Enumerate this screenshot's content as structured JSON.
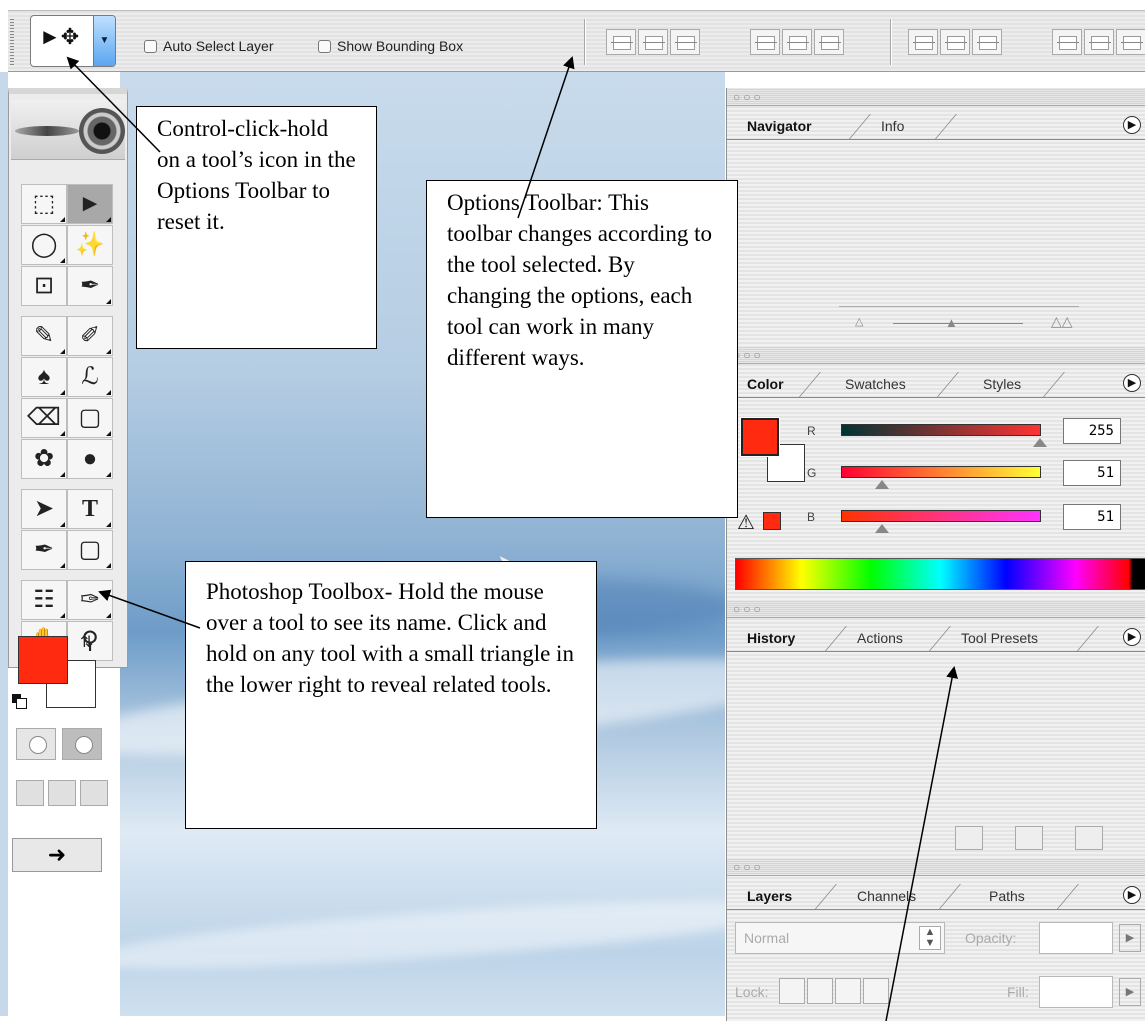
{
  "options_toolbar": {
    "auto_select_label": "Auto Select Layer",
    "show_bbox_label": "Show Bounding Box"
  },
  "palettes": {
    "navigator_tabs": [
      "Navigator",
      "Info"
    ],
    "color_tabs": [
      "Color",
      "Swatches",
      "Styles"
    ],
    "color_values": {
      "r_label": "R",
      "r": "255",
      "g_label": "G",
      "g": "51",
      "b_label": "B",
      "b": "51"
    },
    "history_tabs": [
      "History",
      "Actions",
      "Tool Presets"
    ],
    "layers_tabs": [
      "Layers",
      "Channels",
      "Paths"
    ],
    "layers": {
      "blend_mode": "Normal",
      "opacity_label": "Opacity:",
      "lock_label": "Lock:",
      "fill_label": "Fill:"
    }
  },
  "colors": {
    "foreground": "#ff2a0f",
    "background": "#ffffff"
  },
  "callouts": {
    "control_click": "Control-click-hold on a tool’s icon in the Options Toolbar to reset it.",
    "options_toolbar": "Options Toolbar: This toolbar changes according to the tool selected.  By changing the options, each tool can work in many different ways.",
    "toolbox": "Photoshop Toolbox- Hold the mouse over a tool to see its name.  Click and hold on any tool with a small triangle in the lower right to reveal related tools."
  }
}
